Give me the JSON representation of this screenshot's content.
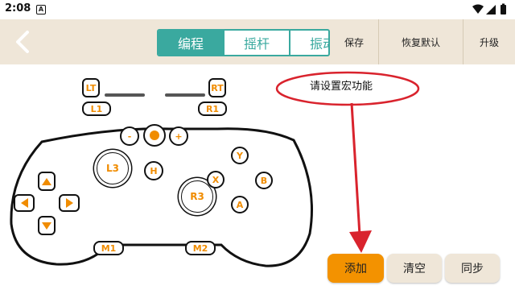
{
  "status": {
    "time": "2:08",
    "notif_letter": "A"
  },
  "header": {
    "tabs": [
      {
        "label": "编程",
        "active": true
      },
      {
        "label": "摇杆",
        "active": false
      },
      {
        "label": "振动",
        "active": false
      }
    ],
    "menu": {
      "save": "保存",
      "reset": "恢复默认",
      "upgrade": "升级"
    }
  },
  "gamepad": {
    "lt": "LT",
    "rt": "RT",
    "l1": "L1",
    "r1": "R1",
    "minus": "-",
    "plus": "+",
    "l3": "L3",
    "r3": "R3",
    "home": "H",
    "x": "X",
    "y": "Y",
    "a": "A",
    "b": "B",
    "m1": "M1",
    "m2": "M2"
  },
  "macro_hint": "请设置宏功能",
  "actions": {
    "add": "添加",
    "clear": "清空",
    "sync": "同步"
  },
  "colors": {
    "accent_teal": "#3aa99f",
    "accent_orange": "#f39200",
    "key_orange": "#f08c00",
    "annotation_red": "#d9232d",
    "header_bg": "#efe6d8"
  }
}
